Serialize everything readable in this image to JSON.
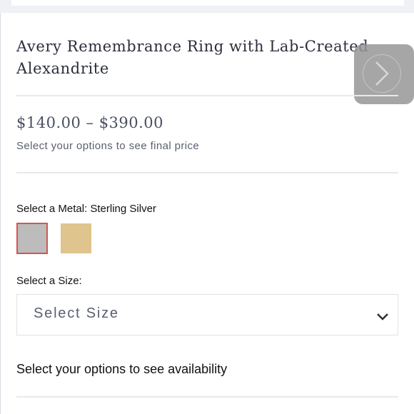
{
  "product": {
    "title": "Avery Remembrance Ring with Lab-Created Alexandrite",
    "price_range": "$140.00 – $390.00",
    "price_note": "Select your options to see final price"
  },
  "metal": {
    "label": "Select a Metal: Sterling Silver",
    "options": [
      {
        "name": "Sterling Silver",
        "color": "#bcbcbc",
        "selected": true
      },
      {
        "name": "Gold",
        "color": "#dfc58d",
        "selected": false
      }
    ]
  },
  "size": {
    "label": "Select a Size:",
    "selected": "Select Size"
  },
  "availability_note": "Select your options to see availability",
  "icons": {
    "next": "chevron-right-icon",
    "dropdown": "chevron-down-icon"
  },
  "colors": {
    "selected_border": "#d9534f",
    "text_primary": "#111111",
    "text_muted": "#5a5f6e"
  }
}
